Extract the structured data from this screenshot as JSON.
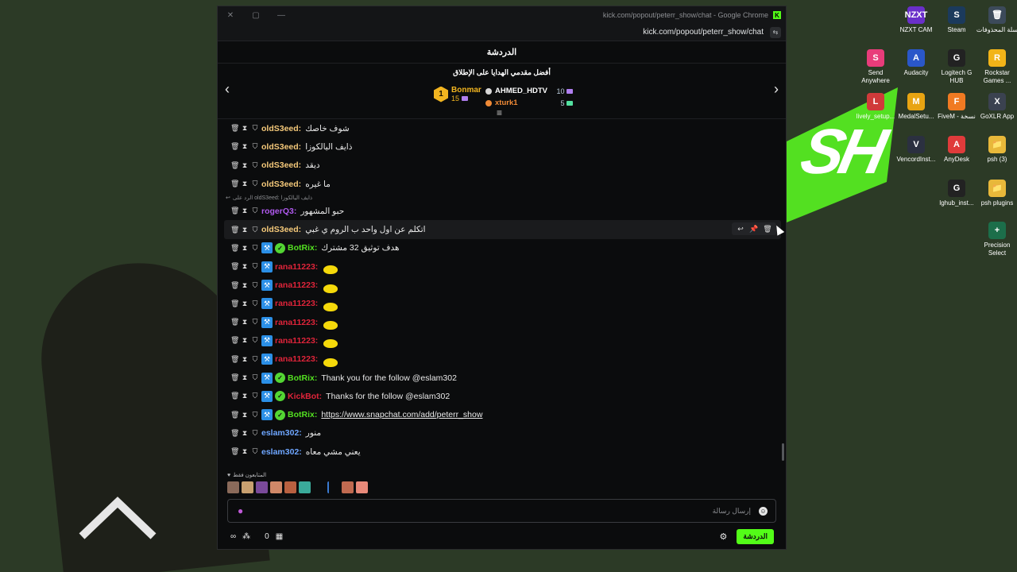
{
  "window": {
    "title": "kick.com/popout/peterr_show/chat - Google Chrome",
    "url": "kick.com/popout/peterr_show/chat",
    "controls": [
      "✕",
      "▢",
      "—"
    ]
  },
  "chat": {
    "header": "الدردشة",
    "gifters_title": "أفضل مقدمي الهدايا على الإطلاق",
    "top_gifter": {
      "rank": "1",
      "name": "Bonmar",
      "count": "15"
    },
    "gifters": [
      {
        "name": "AHMED_HDTV",
        "count": "10"
      },
      {
        "name": "xturk1",
        "count": "5"
      }
    ],
    "reply_context": "الرد على oldS3eed: ذايف اليالكوزا",
    "messages": [
      {
        "user": "oldS3eed:",
        "text": "شوف خاصك",
        "color": "#f5c97a"
      },
      {
        "user": "oldS3eed:",
        "text": "ذايف اليالكوزا",
        "color": "#f5c97a"
      },
      {
        "user": "oldS3eed:",
        "text": "ديقد",
        "color": "#f5c97a"
      },
      {
        "user": "oldS3eed:",
        "text": "ما غيره",
        "color": "#f5c97a"
      },
      {
        "user": "rogerQ3:",
        "text": "حبو المشهور",
        "color": "#b15af0"
      },
      {
        "user": "oldS3eed:",
        "text": "اتكلم عن اول واحد ب الروم ي غبي",
        "color": "#f5c97a"
      },
      {
        "user": "BotRix:",
        "text": "هدف توثيق 32 مشترك",
        "color": "#53e021"
      },
      {
        "user": "rana11223:",
        "text": "",
        "color": "#e0243a"
      },
      {
        "user": "rana11223:",
        "text": "",
        "color": "#e0243a"
      },
      {
        "user": "rana11223:",
        "text": "",
        "color": "#e0243a"
      },
      {
        "user": "rana11223:",
        "text": "",
        "color": "#e0243a"
      },
      {
        "user": "rana11223:",
        "text": "",
        "color": "#e0243a"
      },
      {
        "user": "rana11223:",
        "text": "",
        "color": "#e0243a"
      },
      {
        "user": "BotRix:",
        "text": "Thank you for the follow @eslam302",
        "color": "#53e021"
      },
      {
        "user": "KickBot:",
        "text": "Thanks for the follow @eslam302",
        "color": "#e0243a"
      },
      {
        "user": "BotRix:",
        "text": "https://www.snapchat.com/add/peterr_show",
        "color": "#53e021"
      },
      {
        "user": "eslam302:",
        "text": "منور",
        "color": "#6ea6ff"
      },
      {
        "user": "eslam302:",
        "text": "يعني مشي معاه",
        "color": "#6ea6ff"
      }
    ],
    "followers_label": "المتابعون فقط",
    "input_placeholder": "إرسال رسالة",
    "points": "0",
    "send_button": "الدردشة"
  },
  "desktop_icons": [
    {
      "label": "NZXT CAM",
      "icon": "NZXT",
      "color": "#6a2fc9"
    },
    {
      "label": "Steam",
      "icon": "S",
      "color": "#1b3a5c"
    },
    {
      "label": "سلة المحذوفات",
      "icon": "🗑",
      "color": "#3c4a5a"
    },
    {
      "label": "Send Anywhere",
      "icon": "S",
      "color": "#e83c7a"
    },
    {
      "label": "Audacity",
      "icon": "A",
      "color": "#2a57c9"
    },
    {
      "label": "Logitech G HUB",
      "icon": "G",
      "color": "#222"
    },
    {
      "label": "Rockstar Games ...",
      "icon": "R",
      "color": "#f2b418"
    },
    {
      "label": "lively_setup...",
      "icon": "L",
      "color": "#d03a3a"
    },
    {
      "label": "MedalSetu...",
      "icon": "M",
      "color": "#e8a412"
    },
    {
      "label": "FiveM - نسخة",
      "icon": "F",
      "color": "#f07a22"
    },
    {
      "label": "GoXLR App",
      "icon": "X",
      "color": "#3b4250"
    },
    {
      "label": "VencordInst...",
      "icon": "V",
      "color": "#2b3040"
    },
    {
      "label": "AnyDesk",
      "icon": "A",
      "color": "#e03b3b"
    },
    {
      "label": "psh (3)",
      "icon": "📁",
      "color": "#e8b83a"
    },
    {
      "label": "lghub_inst...",
      "icon": "G",
      "color": "#222"
    },
    {
      "label": "psh plugins",
      "icon": "📁",
      "color": "#e8b83a"
    },
    {
      "label": "Precision Select",
      "icon": "+",
      "color": "#1c6e4a"
    }
  ],
  "background_text": "SH"
}
